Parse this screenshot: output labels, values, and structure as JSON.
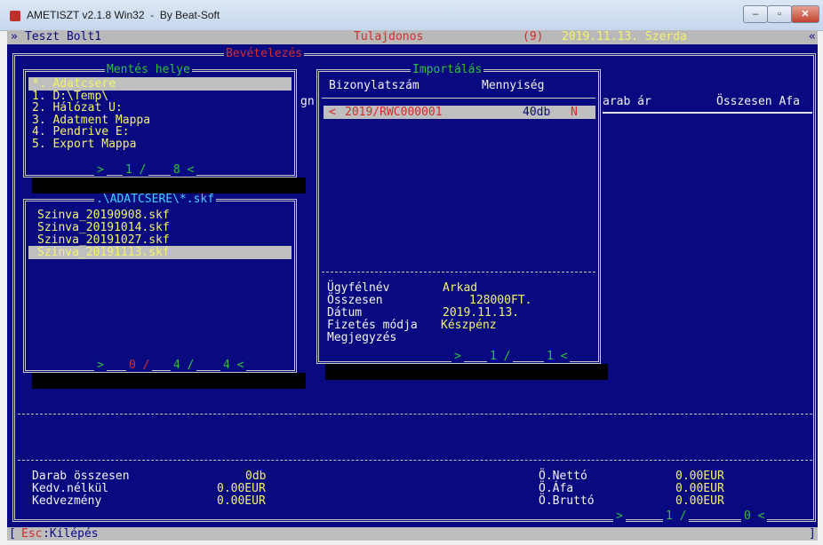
{
  "window": {
    "title": "AMETISZT v2.1.8 Win32  -  By Beat-Soft",
    "minimize": "–",
    "maximize": "▫",
    "close": "✕"
  },
  "header": {
    "prefix": "»",
    "shop": "Teszt Bolt1",
    "owner": "Tulajdonos",
    "count": "(9)",
    "date": "2019.11.13. Szerda",
    "arrow": "«",
    "screen_title": "Bevételezés"
  },
  "bg_columns": {
    "gn": "gn",
    "unit_price": "arab ár",
    "total": "Összesen Afa"
  },
  "save_location": {
    "title": "Mentés helye",
    "items": [
      "*. Adatcsere",
      "1. D:\\Temp\\",
      "2. Hálózat U:",
      "3. Adatment Mappa",
      "4. Pendrive E:",
      "5. Export Mappa"
    ],
    "pager": {
      "arrow_l": ">",
      "current": "1 /",
      "total": "8 <"
    }
  },
  "files": {
    "title": ".\\ADATCSERE\\*.skf",
    "items": [
      "Szinva_20190908.skf",
      "Szinva_20191014.skf",
      "Szinva_20191027.skf",
      "Szinva_20191113.skf"
    ],
    "pager": {
      "arrow_l": ">",
      "a": "0 /",
      "b": "4 /",
      "c": "4 <"
    }
  },
  "import": {
    "title": "Importálás",
    "col_doc": "Bizonylatszám",
    "col_qty": "Mennyiség",
    "row": {
      "marker": "<",
      "doc": "2019/RWC000001",
      "qty": "40db",
      "flag": "N"
    },
    "details": {
      "customer_label": "Ügyfélnév",
      "customer_value": "Arkad",
      "total_label": "Összesen",
      "total_value": "128000FT.",
      "date_label": "Dátum",
      "date_value": "2019.11.13.",
      "payment_label": "Fizetés módja",
      "payment_value": "Készpénz",
      "note_label": "Megjegyzés"
    },
    "pager": {
      "arrow_l": ">",
      "current": "1 /",
      "total": "1 <"
    }
  },
  "summary": {
    "pieces_label": "Darab összesen",
    "pieces_value": "0db",
    "no_discount_label": "Kedv.nélkül",
    "no_discount_value": "0.00EUR",
    "discount_label": "Kedvezmény",
    "discount_value": "0.00EUR",
    "net_label": "Ö.Nettó",
    "net_value": "0.00EUR",
    "vat_label": "Ö.Áfa",
    "vat_value": "0.00EUR",
    "gross_label": "Ö.Bruttó",
    "gross_value": "0.00EUR",
    "pager": {
      "arrow_l": ">",
      "current": "1 /",
      "total": "0 <"
    }
  },
  "statusbar": {
    "left_bracket": "[",
    "esc_key": "Esc",
    "esc_text": ":Kilépés",
    "right_bracket": "]"
  }
}
